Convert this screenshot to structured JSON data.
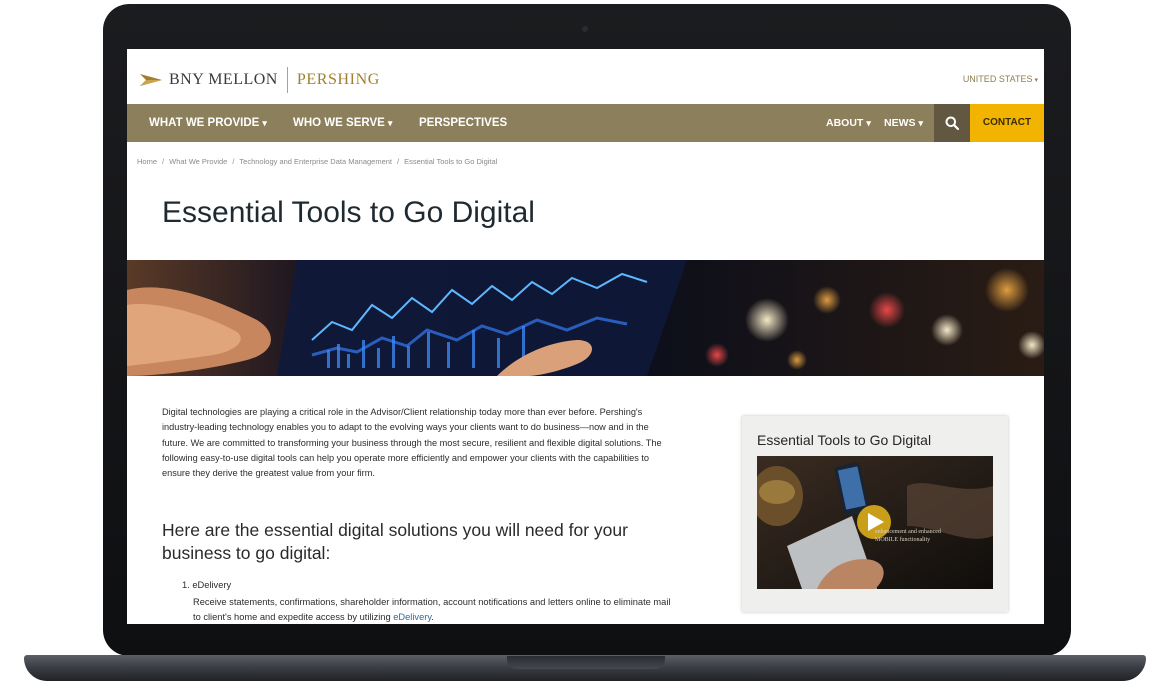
{
  "header": {
    "brand_primary": "BNY MELLON",
    "brand_secondary": "PERSHING",
    "region": "UNITED STATES"
  },
  "nav": {
    "items": [
      {
        "label": "WHAT WE PROVIDE",
        "dropdown": true
      },
      {
        "label": "WHO WE SERVE",
        "dropdown": true
      },
      {
        "label": "PERSPECTIVES",
        "dropdown": false
      }
    ],
    "right_items": [
      {
        "label": "ABOUT",
        "dropdown": true
      },
      {
        "label": "NEWS",
        "dropdown": true
      }
    ],
    "search_icon": "search-icon",
    "contact_label": "CONTACT"
  },
  "breadcrumb": [
    "Home",
    "What We Provide",
    "Technology and Enterprise Data Management",
    "Essential Tools to Go Digital"
  ],
  "page": {
    "title": "Essential Tools to Go Digital",
    "intro": "Digital technologies are playing a critical role in the Advisor/Client relationship today more than ever before. Pershing's industry-leading technology enables you to adapt to the evolving ways your clients want to do business—now and in the future. We are committed to transforming your business through the most secure, resilient and flexible digital solutions. The following easy-to-use digital tools can help you operate more efficiently and empower your clients with the capabilities to ensure they derive the greatest value from your firm.",
    "subheading": "Here are the essential digital solutions you will need for your business to go digital:",
    "list": [
      {
        "number": "1.",
        "title": "eDelivery",
        "description": "Receive statements, confirmations, shareholder information, account notifications and letters online to eliminate mail to client's home and expedite access by utilizing",
        "link_text": "eDelivery",
        "link_suffix": "."
      }
    ]
  },
  "sidebar": {
    "card_title": "Essential Tools to Go Digital",
    "video_caption_line1": "enhancement and enhanced",
    "video_caption_line2": "MOBILE functionality"
  },
  "colors": {
    "nav_bg": "#8c7f5b",
    "search_bg": "#625842",
    "contact_bg": "#f2b400",
    "brand_gold": "#a07f2f",
    "link": "#2a6e9a"
  }
}
